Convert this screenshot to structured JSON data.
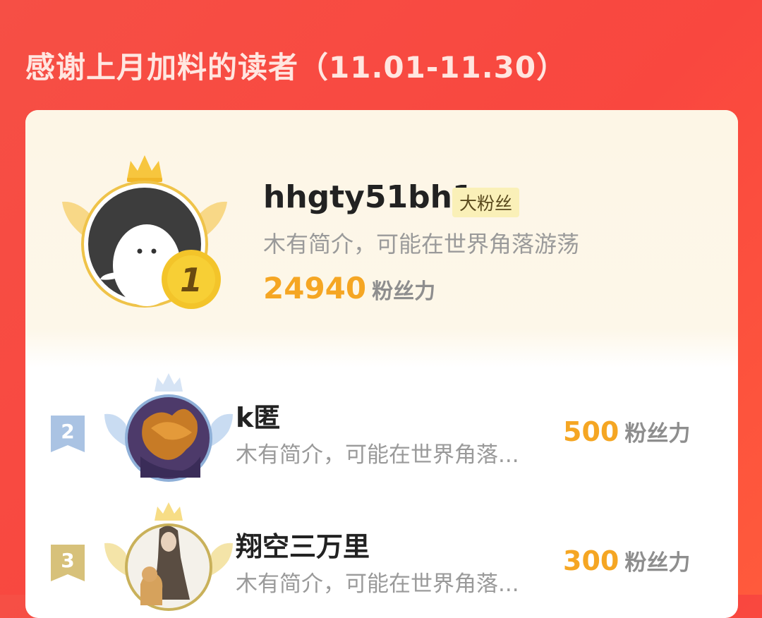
{
  "header": {
    "title": "感谢上月加料的读者（11.01-11.30）"
  },
  "top_reader": {
    "rank": "1",
    "name": "hhgty51bh1",
    "badge": "大粉丝",
    "bio": "木有简介，可能在世界角落游荡",
    "score": "24940",
    "score_unit": "粉丝力"
  },
  "readers": [
    {
      "rank": "2",
      "name": "k匿",
      "bio": "木有简介，可能在世界角落...",
      "score": "500",
      "score_unit": "粉丝力"
    },
    {
      "rank": "3",
      "name": "翔空三万里",
      "bio": "木有简介，可能在世界角落...",
      "score": "300",
      "score_unit": "粉丝力"
    }
  ],
  "colors": {
    "accent": "#f5a623",
    "background": "#f64f45",
    "gold": "#e8b83a",
    "silver": "#a9c1e0"
  }
}
